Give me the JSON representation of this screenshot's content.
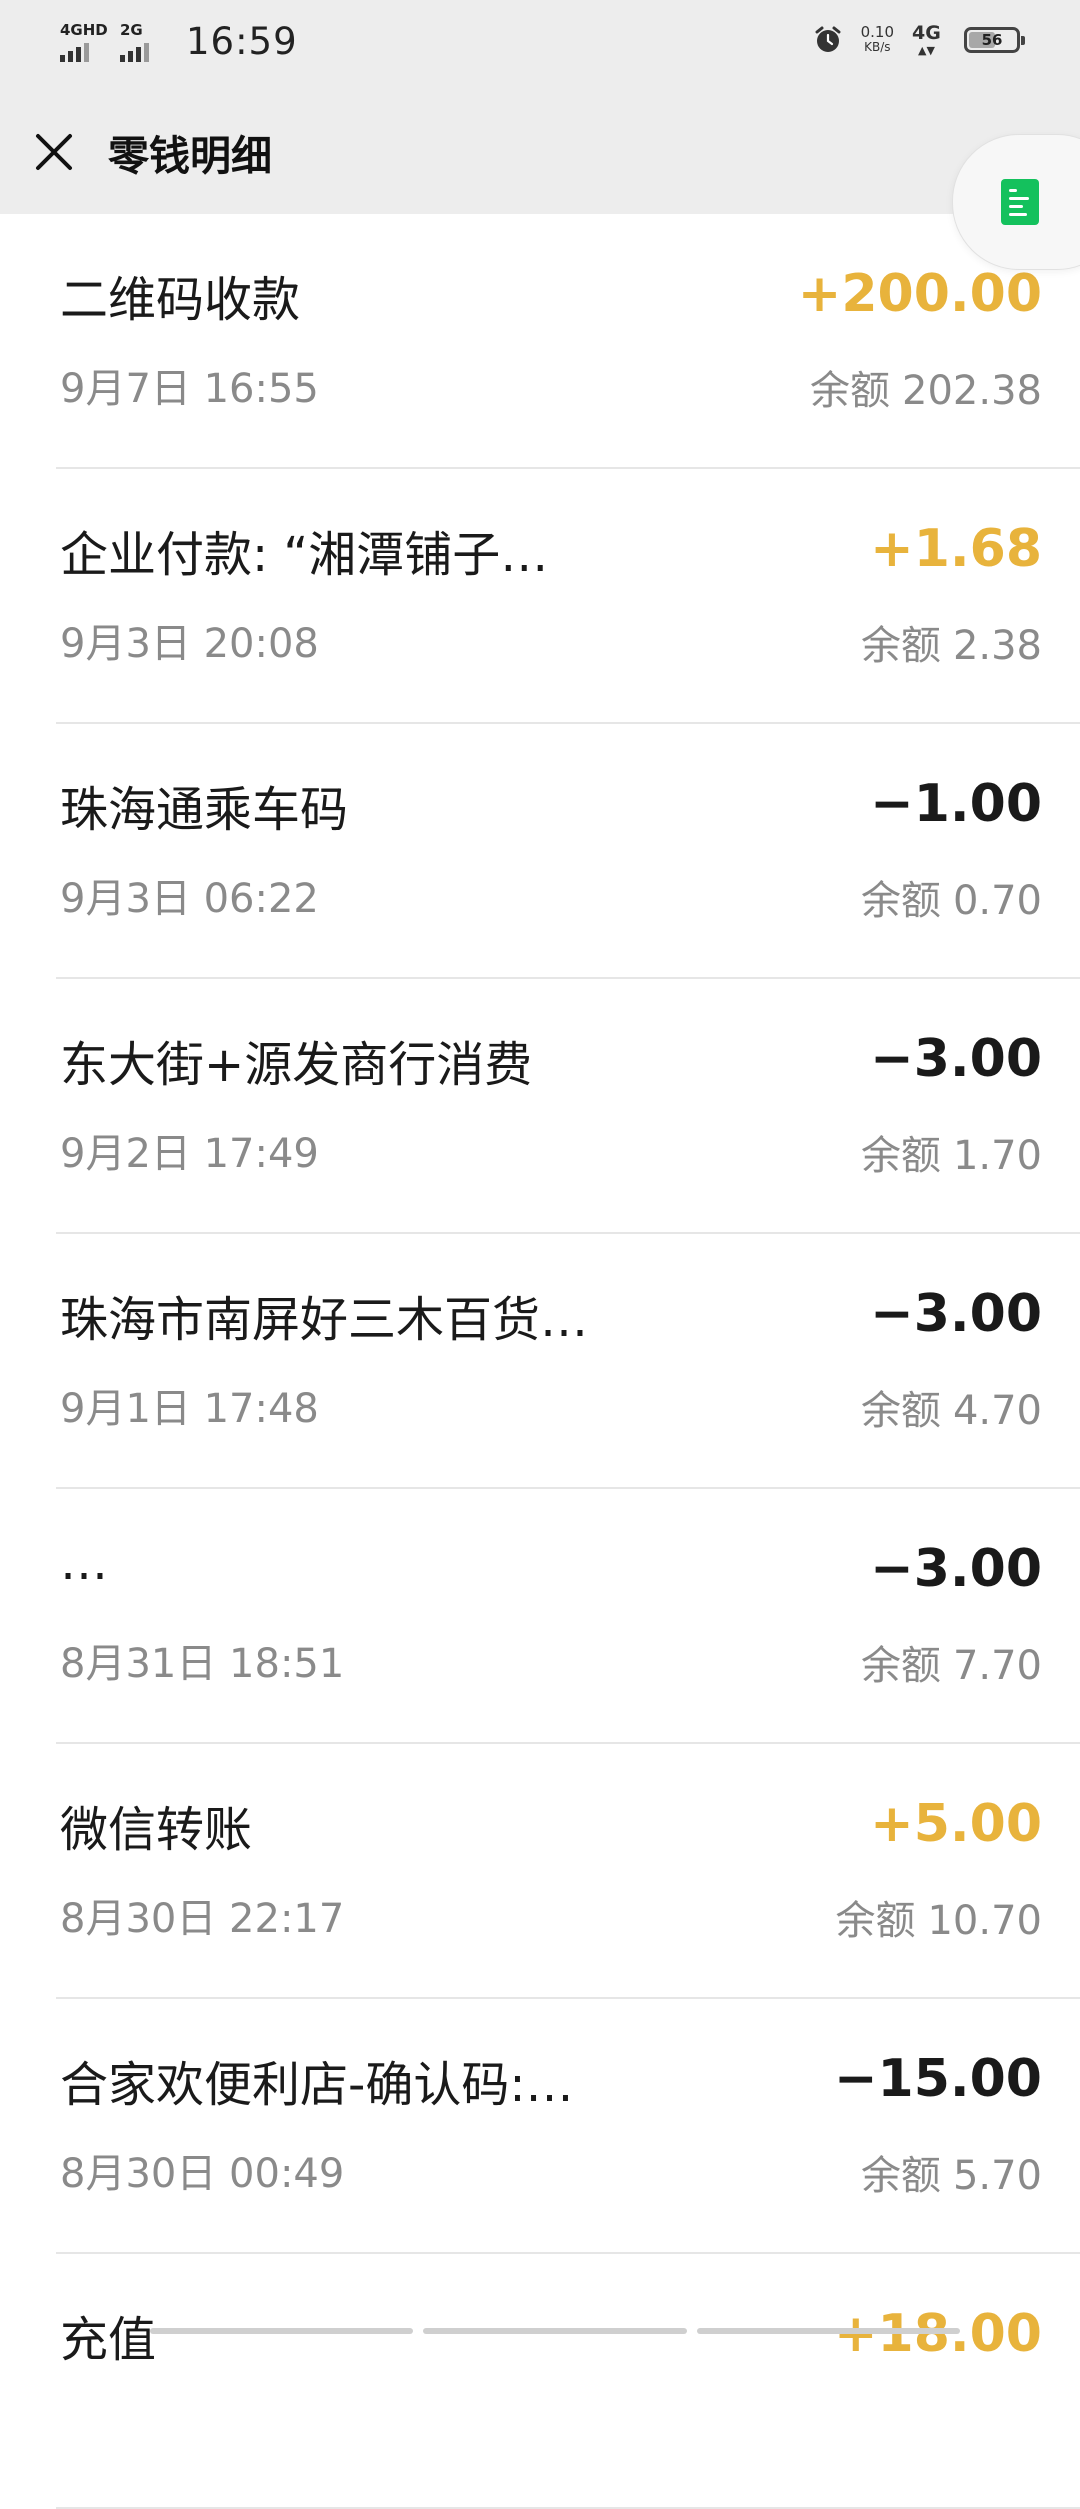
{
  "status_bar": {
    "network_1": "4GHD",
    "network_2": "2G",
    "time": "16:59",
    "speed_value": "0.10",
    "speed_unit": "KB/s",
    "network_right": "4G",
    "battery_level": "56"
  },
  "header": {
    "title": "零钱明细",
    "close_icon": "close-icon",
    "float_icon": "document-icon"
  },
  "balance_label": "余额",
  "transactions": [
    {
      "title": "二维码收款",
      "date": "9月7日 16:55",
      "amount": "+200.00",
      "direction": "income",
      "balance": "202.38"
    },
    {
      "title": "企业付款: “湘潭铺子…",
      "date": "9月3日 20:08",
      "amount": "+1.68",
      "direction": "income",
      "balance": "2.38"
    },
    {
      "title": "珠海通乘车码",
      "date": "9月3日 06:22",
      "amount": "−1.00",
      "direction": "expense",
      "balance": "0.70"
    },
    {
      "title": "东大街+源发商行消费",
      "date": "9月2日 17:49",
      "amount": "−3.00",
      "direction": "expense",
      "balance": "1.70"
    },
    {
      "title": "珠海市南屏好三木百货…",
      "date": "9月1日 17:48",
      "amount": "−3.00",
      "direction": "expense",
      "balance": "4.70"
    },
    {
      "title": "…",
      "date": "8月31日 18:51",
      "amount": "−3.00",
      "direction": "expense",
      "balance": "7.70"
    },
    {
      "title": "微信转账",
      "date": "8月30日 22:17",
      "amount": "+5.00",
      "direction": "income",
      "balance": "10.70"
    },
    {
      "title": "合家欢便利店-确认码:…",
      "date": "8月30日 00:49",
      "amount": "−15.00",
      "direction": "expense",
      "balance": "5.70"
    },
    {
      "title": "充值",
      "date": "",
      "amount": "+18.00",
      "direction": "income",
      "balance": ""
    }
  ],
  "colors": {
    "income": "#e8b33c",
    "expense": "#1a1a1a",
    "header_bg": "#ededed",
    "float_icon": "#14c15d"
  }
}
